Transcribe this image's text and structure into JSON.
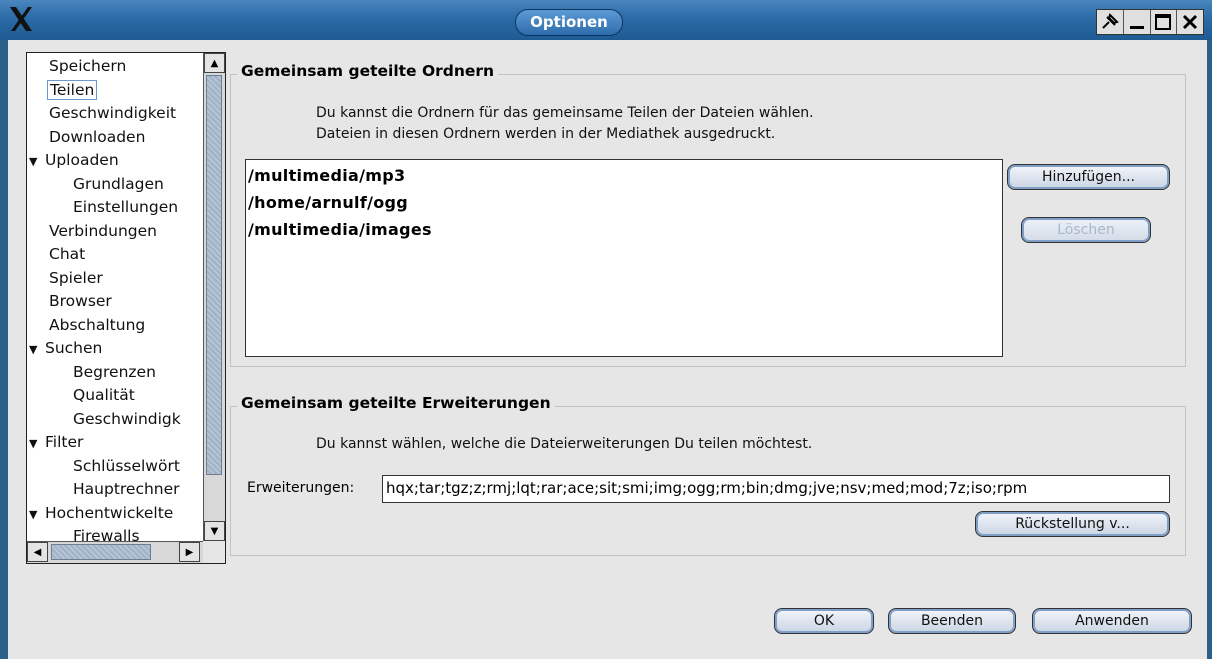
{
  "window": {
    "title": "Optionen"
  },
  "tree": {
    "items": [
      {
        "label": "Speichern",
        "level": 0
      },
      {
        "label": "Teilen",
        "level": 0,
        "selected": true
      },
      {
        "label": "Geschwindigkeit",
        "level": 0
      },
      {
        "label": "Downloaden",
        "level": 0
      },
      {
        "label": "Uploaden",
        "level": 0,
        "expanded": true
      },
      {
        "label": "Grundlagen",
        "level": 1
      },
      {
        "label": "Einstellungen",
        "level": 1
      },
      {
        "label": "Verbindungen",
        "level": 0
      },
      {
        "label": "Chat",
        "level": 0
      },
      {
        "label": "Spieler",
        "level": 0
      },
      {
        "label": "Browser",
        "level": 0
      },
      {
        "label": "Abschaltung",
        "level": 0
      },
      {
        "label": "Suchen",
        "level": 0,
        "expanded": true
      },
      {
        "label": "Begrenzen",
        "level": 1
      },
      {
        "label": "Qualität",
        "level": 1
      },
      {
        "label": "Geschwindigk",
        "level": 1
      },
      {
        "label": "Filter",
        "level": 0,
        "expanded": true
      },
      {
        "label": "Schlüsselwört",
        "level": 1
      },
      {
        "label": "Hauptrechner",
        "level": 1
      },
      {
        "label": "Hochentwickelte",
        "level": 0,
        "expanded": true
      },
      {
        "label": "Firewalls",
        "level": 1
      }
    ]
  },
  "shared_folders": {
    "title": "Gemeinsam geteilte Ordnern",
    "desc_line1": "Du kannst die Ordnern für das gemeinsame Teilen der Dateien wählen.",
    "desc_line2": "Dateien in diesen Ordnern werden in der Mediathek ausgedruckt.",
    "folders": [
      "/multimedia/mp3",
      "/home/arnulf/ogg",
      "/multimedia/images"
    ],
    "add_label": "Hinzufügen...",
    "delete_label": "Löschen"
  },
  "shared_extensions": {
    "title": "Gemeinsam geteilte Erweiterungen",
    "desc": "Du kannst wählen, welche die Dateierweiterungen Du teilen möchtest.",
    "field_label": "Erweiterungen:",
    "field_value": "hqx;tar;tgz;z;rmj;lqt;rar;ace;sit;smi;img;ogg;rm;bin;dmg;jve;nsv;med;mod;7z;iso;rpm",
    "reset_label": "Rückstellung v..."
  },
  "footer": {
    "ok_label": "OK",
    "cancel_label": "Beenden",
    "apply_label": "Anwenden"
  }
}
